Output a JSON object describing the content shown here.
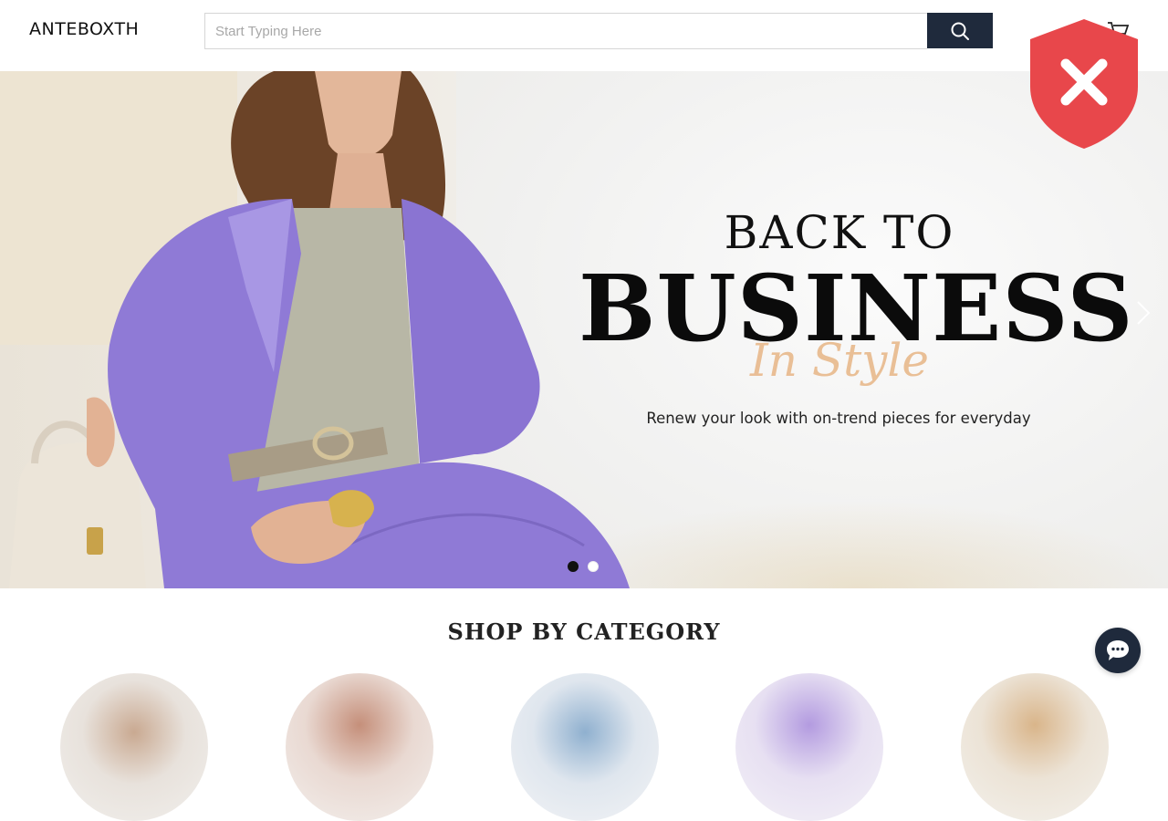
{
  "header": {
    "logo": "ANTEBOXTH",
    "search": {
      "placeholder": "Start Typing Here",
      "value": ""
    },
    "search_icon": "search-icon",
    "cart_icon": "cart-icon"
  },
  "overlay": {
    "icon": "shield-x-icon",
    "color": "#e8474b"
  },
  "hero": {
    "line1": "BACK TO",
    "line2": "BUSINESS",
    "script": "In Style",
    "subtitle": "Renew your look with on-trend pieces for everyday",
    "slides": 2,
    "active_slide": 1,
    "next_icon": "chevron-right-icon"
  },
  "categories": {
    "title": "SHOP BY CATEGORY",
    "count": 5
  },
  "chat": {
    "icon": "chat-bubble-icon"
  },
  "colors": {
    "brand_dark": "#1f2a3c",
    "accent_peach": "#e8b98c",
    "suit_lavender": "#8f7ad6"
  }
}
